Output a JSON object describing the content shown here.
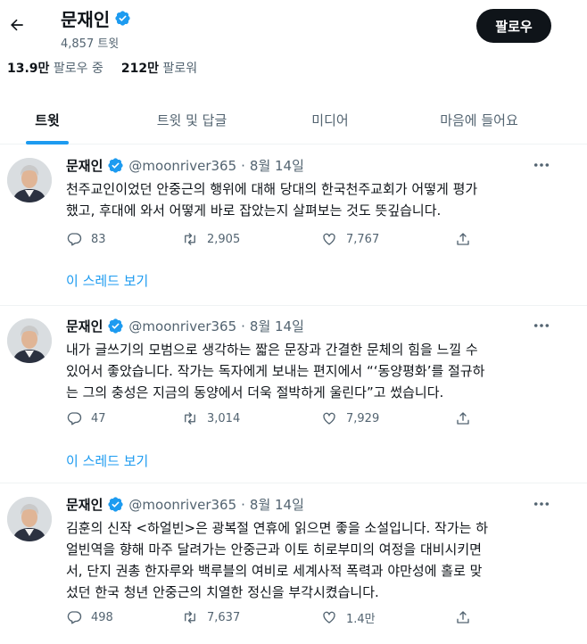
{
  "header": {
    "title": "문재인",
    "tweet_count": "4,857 트윗",
    "follow_label": "팔로우"
  },
  "stats": {
    "following_num": "13.9만",
    "following_label": "팔로우 중",
    "followers_num": "212만",
    "followers_label": "팔로워"
  },
  "tabs": [
    {
      "label": "트윗",
      "active": true
    },
    {
      "label": "트윗 및 답글",
      "active": false
    },
    {
      "label": "미디어",
      "active": false
    },
    {
      "label": "마음에 들어요",
      "active": false
    }
  ],
  "tweets": [
    {
      "name": "문재인",
      "handle": "@moonriver365",
      "dot": "·",
      "date": "8월 14일",
      "lines": [
        "천주교인이었던 안중근의 행위에 대해 당대의 한국천주교회가 어떻게 평가",
        "했고, 후대에 와서 어떻게 바로 잡았는지 살펴보는 것도 뜻깊습니다."
      ],
      "replies": "83",
      "retweets": "2,905",
      "likes": "7,767",
      "thread_link": "이 스레드 보기"
    },
    {
      "name": "문재인",
      "handle": "@moonriver365",
      "dot": "·",
      "date": "8월 14일",
      "lines": [
        "내가 글쓰기의 모범으로 생각하는 짧은 문장과 간결한 문체의 힘을 느낄 수",
        "있어서 좋았습니다. 작가는 독자에게 보내는 편지에서 “‘동양평화’를 절규하",
        "는 그의 충성은 지금의 동양에서 더욱 절박하게 울린다”고 썼습니다."
      ],
      "replies": "47",
      "retweets": "3,014",
      "likes": "7,929",
      "thread_link": "이 스레드 보기"
    },
    {
      "name": "문재인",
      "handle": "@moonriver365",
      "dot": "·",
      "date": "8월 14일",
      "lines": [
        "김훈의 신작 <하얼빈>은 광복절 연휴에 읽으면 좋을 소설입니다. 작가는 하",
        "얼빈역을 향해 마주 달려가는 안중근과 이토 히로부미의 여정을 대비시키면",
        "서, 단지 권총 한자루와 백루블의 여비로 세계사적 폭력과 야만성에 홀로 맞",
        "섰던 한국 청년 안중근의 치열한 정신을 부각시켰습니다."
      ],
      "replies": "498",
      "retweets": "7,637",
      "likes": "1.4만"
    }
  ],
  "colors": {
    "accent": "#1d9bf0",
    "text": "#0f1419",
    "muted": "#536471",
    "border": "#eff3f4",
    "button_bg": "#0f1419"
  },
  "icons": {
    "back": "arrow-left-icon",
    "verified": "verified-badge-icon",
    "more": "more-dots-icon",
    "reply": "reply-bubble-icon",
    "retweet": "retweet-icon",
    "like": "heart-icon",
    "share": "share-icon"
  }
}
